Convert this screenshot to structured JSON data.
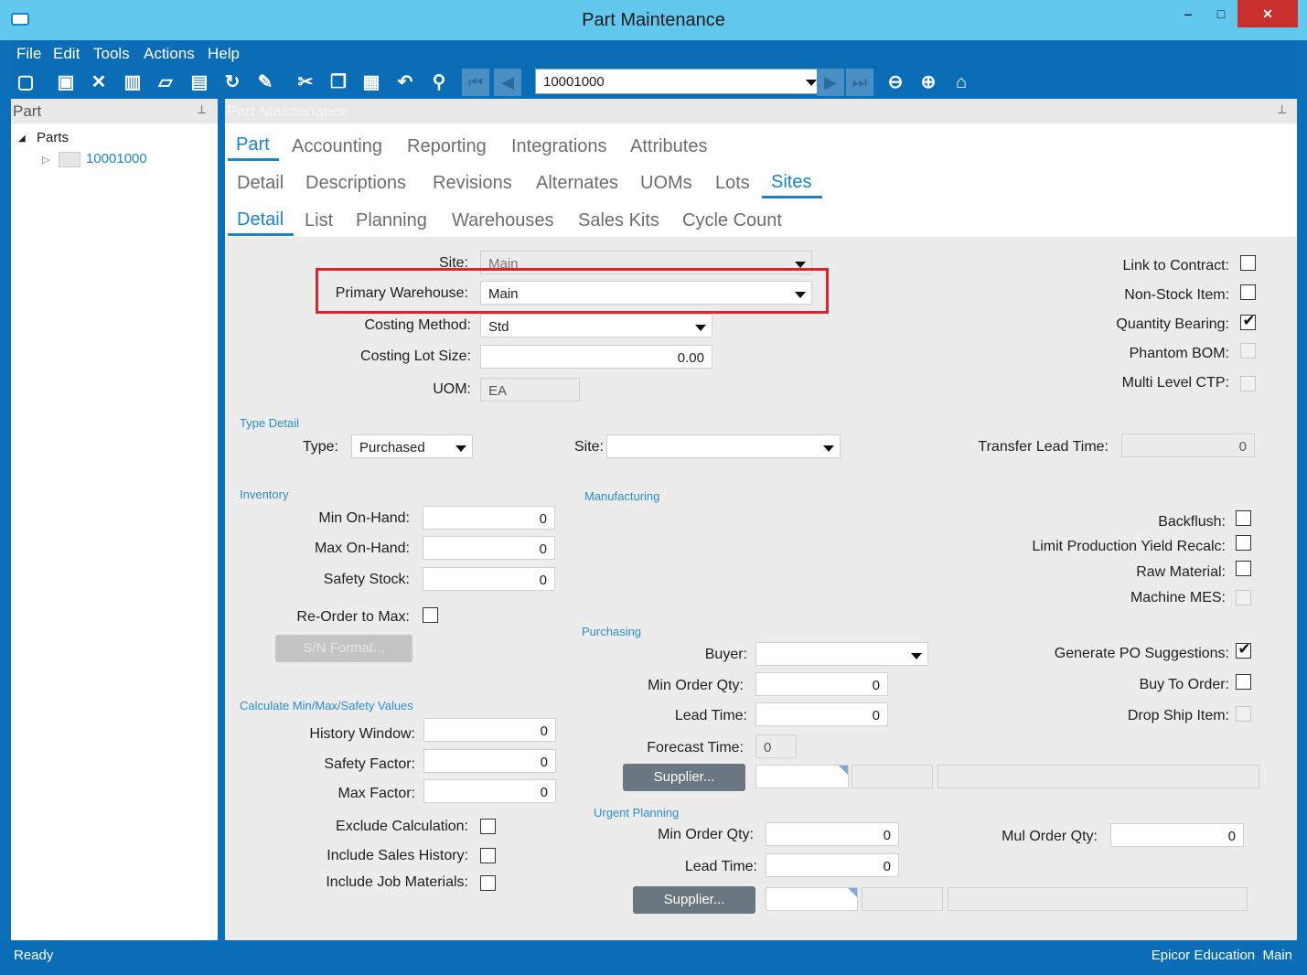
{
  "window": {
    "title": "Part Maintenance",
    "minimize": "‒",
    "maximize": "□",
    "close": "✕"
  },
  "menu": [
    "File",
    "Edit",
    "Tools",
    "Actions",
    "Help"
  ],
  "toolbar": {
    "part_value": "10001000"
  },
  "left_pane": {
    "title": "Part",
    "tree_root": "Parts",
    "tree_item": "10001000"
  },
  "right_pane": {
    "title": "Part Maintenance"
  },
  "tabs": {
    "row1": [
      "Part",
      "Accounting",
      "Reporting",
      "Integrations",
      "Attributes"
    ],
    "row2": [
      "Detail",
      "Descriptions",
      "Revisions",
      "Alternates",
      "UOMs",
      "Lots",
      "Sites"
    ],
    "row3": [
      "Detail",
      "List",
      "Planning",
      "Warehouses",
      "Sales Kits",
      "Cycle Count"
    ]
  },
  "site_section": {
    "site_label": "Site:",
    "site_value": "Main",
    "primary_wh_label": "Primary Warehouse:",
    "primary_wh_value": "Main",
    "costing_method_label": "Costing Method:",
    "costing_method_value": "Std",
    "costing_lot_label": "Costing Lot Size:",
    "costing_lot_value": "0.00",
    "uom_label": "UOM:",
    "uom_value": "EA"
  },
  "flags": {
    "link_contract": "Link to Contract:",
    "non_stock": "Non-Stock Item:",
    "qty_bearing": "Quantity Bearing:",
    "phantom_bom": "Phantom BOM:",
    "multi_ctp": "Multi Level CTP:"
  },
  "type_detail": {
    "group": "Type Detail",
    "type_label": "Type:",
    "type_value": "Purchased",
    "site_label": "Site:",
    "transfer_label": "Transfer Lead Time:",
    "transfer_value": "0"
  },
  "inventory": {
    "group": "Inventory",
    "min_label": "Min On-Hand:",
    "min_value": "0",
    "max_label": "Max On-Hand:",
    "max_value": "0",
    "safety_label": "Safety Stock:",
    "safety_value": "0",
    "reorder_label": "Re-Order to Max:",
    "sn_button": "S/N Format..."
  },
  "calc": {
    "group": "Calculate Min/Max/Safety Values",
    "history_label": "History Window:",
    "history_value": "0",
    "safety_factor_label": "Safety Factor:",
    "safety_factor_value": "0",
    "max_factor_label": "Max Factor:",
    "max_factor_value": "0",
    "exclude_label": "Exclude Calculation:",
    "sales_label": "Include Sales History:",
    "job_label": "Include Job Materials:"
  },
  "manufacturing": {
    "group": "Manufacturing",
    "backflush": "Backflush:",
    "limit_yield": "Limit Production Yield Recalc:",
    "raw_material": "Raw Material:",
    "machine_mes": "Machine MES:"
  },
  "purchasing": {
    "group": "Purchasing",
    "buyer_label": "Buyer:",
    "min_order_label": "Min Order Qty:",
    "min_order_value": "0",
    "lead_label": "Lead Time:",
    "lead_value": "0",
    "forecast_label": "Forecast Time:",
    "forecast_value": "0",
    "supplier_button": "Supplier...",
    "gen_po": "Generate PO Suggestions:",
    "buy_to_order": "Buy To Order:",
    "drop_ship": "Drop Ship Item:"
  },
  "urgent": {
    "group": "Urgent Planning",
    "min_order_label": "Min Order Qty:",
    "min_order_value": "0",
    "lead_label": "Lead Time:",
    "lead_value": "0",
    "mul_label": "Mul Order Qty:",
    "mul_value": "0",
    "supplier_button": "Supplier..."
  },
  "status": {
    "left": "Ready",
    "right": "Epicor Education  Main"
  }
}
